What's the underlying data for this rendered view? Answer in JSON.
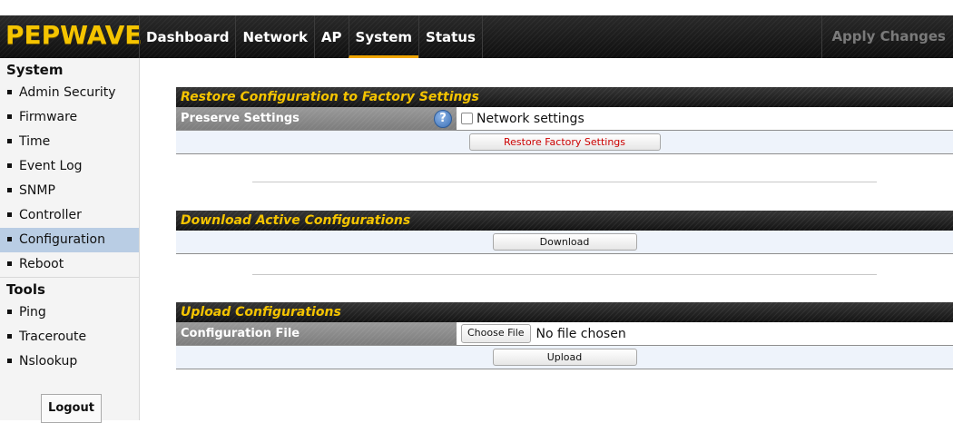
{
  "brand": {
    "logo": "PEPWAVE"
  },
  "nav": {
    "items": [
      "Dashboard",
      "Network",
      "AP",
      "System",
      "Status"
    ],
    "active": "System",
    "apply_label": "Apply Changes"
  },
  "sidebar": {
    "system_heading": "System",
    "system_items": [
      "Admin Security",
      "Firmware",
      "Time",
      "Event Log",
      "SNMP",
      "Controller",
      "Configuration",
      "Reboot"
    ],
    "active_item": "Configuration",
    "tools_heading": "Tools",
    "tools_items": [
      "Ping",
      "Traceroute",
      "Nslookup"
    ],
    "logout_label": "Logout"
  },
  "restore": {
    "title": "Restore Configuration to Factory Settings",
    "preserve_label": "Preserve Settings",
    "help_glyph": "?",
    "checkbox_label": "Network settings",
    "checkbox_checked": false,
    "button_label": "Restore Factory Settings",
    "button_color": "#cc0000"
  },
  "download": {
    "title": "Download Active Configurations",
    "button_label": "Download"
  },
  "upload": {
    "title": "Upload Configurations",
    "file_label": "Configuration File",
    "choose_label": "Choose File",
    "file_status": "No file chosen",
    "button_label": "Upload"
  },
  "colors": {
    "brand_yellow": "#f5c400",
    "nav_active_underline": "#f0a500",
    "sidebar_active": "#b9cde4"
  },
  "icons": {
    "help": "help-question-icon",
    "bullet": "square-bullet-icon"
  }
}
